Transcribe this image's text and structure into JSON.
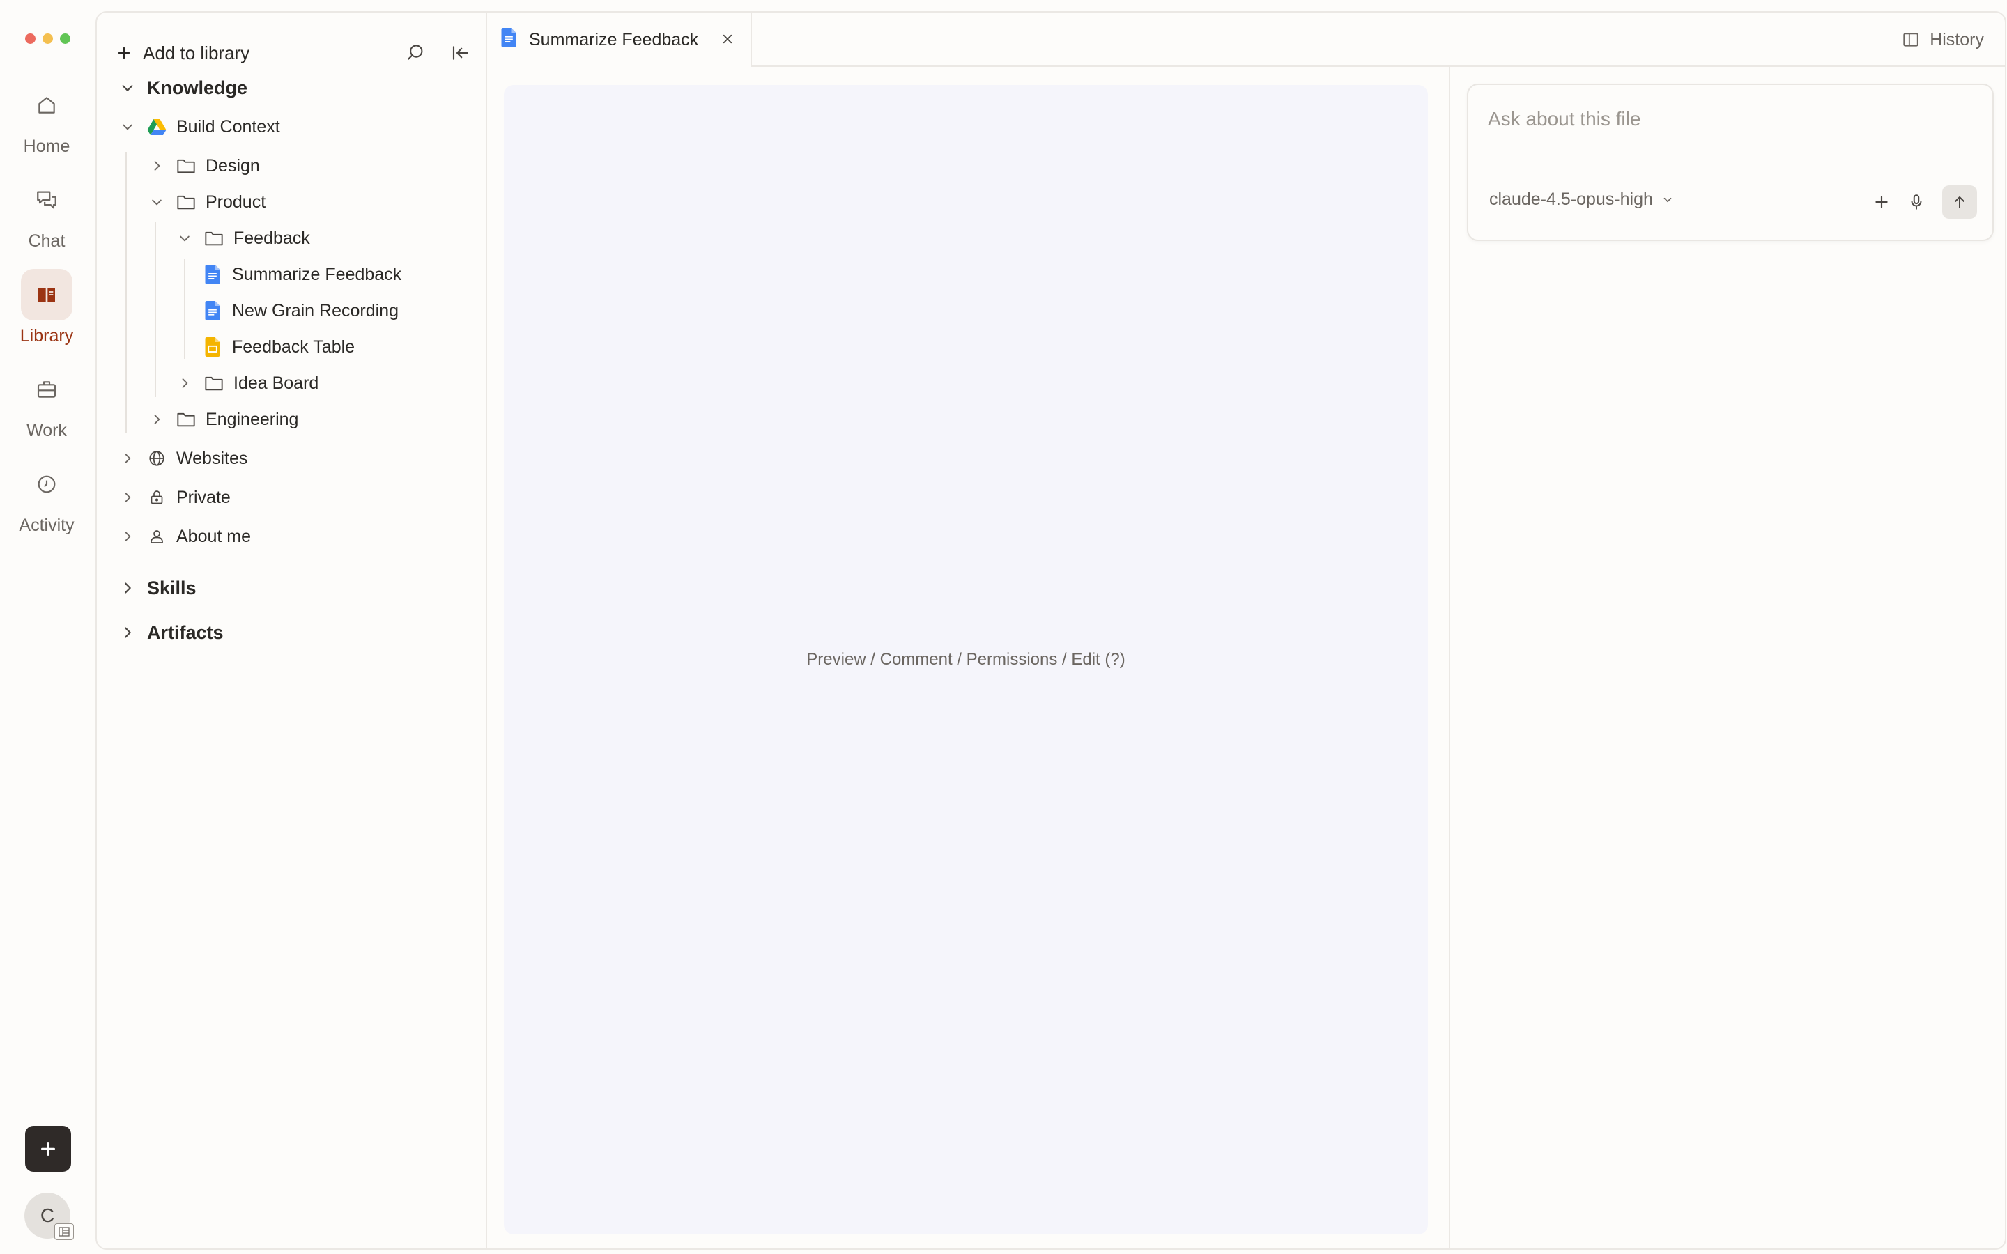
{
  "window_controls": {
    "colors": [
      "#ec6a5e",
      "#f4bf4f",
      "#61c554"
    ]
  },
  "rail": {
    "items": [
      {
        "label": "Home",
        "icon": "home-icon",
        "active": false
      },
      {
        "label": "Chat",
        "icon": "chat-icon",
        "active": false
      },
      {
        "label": "Library",
        "icon": "library-icon",
        "active": true
      },
      {
        "label": "Work",
        "icon": "briefcase-icon",
        "active": false
      },
      {
        "label": "Activity",
        "icon": "clock-icon",
        "active": false
      }
    ],
    "new_button_icon": "plus-icon",
    "avatar_initial": "C",
    "accent_color": "#9b3413"
  },
  "sidebar": {
    "add_label": "Add to library",
    "knowledge": "Knowledge",
    "build_context": "Build Context",
    "design": "Design",
    "product": "Product",
    "feedback": "Feedback",
    "summarize_feedback": "Summarize Feedback",
    "new_grain_recording": "New Grain Recording",
    "feedback_table": "Feedback Table",
    "idea_board": "Idea Board",
    "engineering": "Engineering",
    "websites": "Websites",
    "private": "Private",
    "about_me": "About me",
    "skills": "Skills",
    "artifacts": "Artifacts"
  },
  "tab": {
    "title": "Summarize Feedback"
  },
  "history_label": "History",
  "preview": {
    "text": "Preview / Comment / Permissions / Edit (?)"
  },
  "ask": {
    "placeholder": "Ask about this file",
    "model": "claude-4.5-opus-high"
  }
}
